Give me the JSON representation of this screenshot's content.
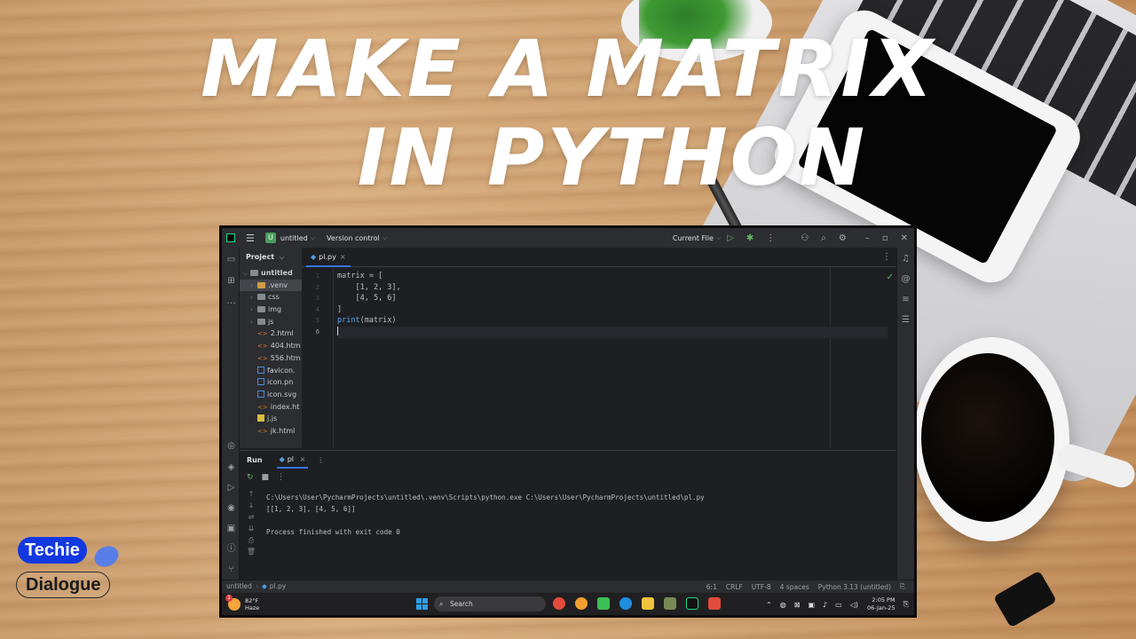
{
  "headline": {
    "line1": "MAKE A MATRIX",
    "line2": "IN PYTHON"
  },
  "branding": {
    "top": "Techie",
    "bottom": "Dialogue"
  },
  "ide": {
    "titlebar": {
      "project_badge": "U",
      "project_name": "untitled",
      "vcs": "Version control",
      "run_config": "Current File"
    },
    "project_panel": {
      "title": "Project",
      "root": "untitled",
      "items": [
        {
          "name": ".venv",
          "type": "folder-venv"
        },
        {
          "name": "css",
          "type": "folder"
        },
        {
          "name": "img",
          "type": "folder"
        },
        {
          "name": "js",
          "type": "folder"
        },
        {
          "name": "2.html",
          "type": "html"
        },
        {
          "name": "404.htm",
          "type": "html"
        },
        {
          "name": "556.htm",
          "type": "html"
        },
        {
          "name": "favicon.",
          "type": "image"
        },
        {
          "name": "icon.pn",
          "type": "image"
        },
        {
          "name": "icon.svg",
          "type": "image"
        },
        {
          "name": "index.ht",
          "type": "html"
        },
        {
          "name": "j.js",
          "type": "js"
        },
        {
          "name": "jk.html",
          "type": "html"
        }
      ]
    },
    "editor": {
      "tab": "pl.py",
      "line_numbers": [
        "1",
        "2",
        "3",
        "4",
        "5",
        "6"
      ],
      "code_lines": [
        "matrix = [",
        "    [1, 2, 3],",
        "    [4, 5, 6]",
        "]",
        "print(matrix)",
        ""
      ],
      "current_line": 6
    },
    "run_panel": {
      "title": "Run",
      "tab": "pl",
      "console": [
        "C:\\Users\\User\\PycharmProjects\\untitled\\.venv\\Scripts\\python.exe C:\\Users\\User\\PycharmProjects\\untitled\\pl.py",
        "[[1, 2, 3], [4, 5, 6]]",
        "",
        "Process finished with exit code 0"
      ]
    },
    "statusbar": {
      "crumb_project": "untitled",
      "crumb_file": "pl.py",
      "position": "6:1",
      "line_ending": "CRLF",
      "encoding": "UTF-8",
      "indent": "4 spaces",
      "interpreter": "Python 3.13 (untitled)"
    }
  },
  "taskbar": {
    "weather_temp": "82°F",
    "weather_desc": "Haze",
    "weather_badge": "1",
    "search_placeholder": "Search",
    "time": "2:05 PM",
    "date": "06-Jan-25"
  }
}
